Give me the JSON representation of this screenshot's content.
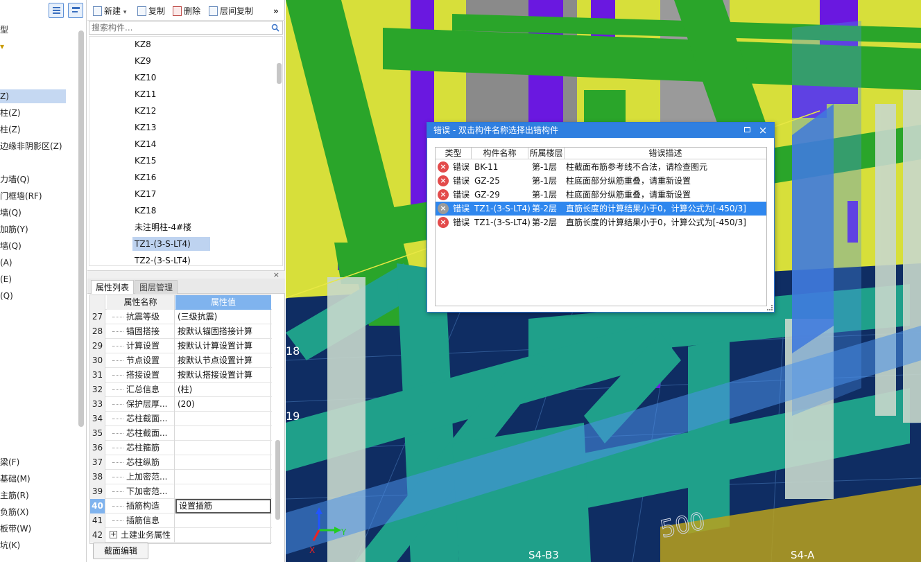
{
  "left_tree": {
    "items": [
      "型",
      "",
      "",
      "",
      "Z)",
      "柱(Z)",
      "柱(Z)",
      "边缘非阴影区(Z)",
      "",
      "力墙(Q)",
      "门框墙(RF)",
      "墙(Q)",
      "加筋(Y)",
      "墙(Q)",
      "(A)",
      "(E)",
      "(Q)",
      "梁(F)",
      "基础(M)",
      "主筋(R)",
      "负筋(X)",
      "板带(W)",
      "坑(K)"
    ]
  },
  "toolbar": {
    "new_label": "新建",
    "copy_label": "复制",
    "delete_label": "删除",
    "floor_copy_label": "层间复制",
    "more_label": "»"
  },
  "search": {
    "placeholder": "搜索构件..."
  },
  "component_list": [
    "KZ8",
    "KZ9",
    "KZ10",
    "KZ11",
    "KZ12",
    "KZ13",
    "KZ14",
    "KZ15",
    "KZ16",
    "KZ17",
    "KZ18",
    "未注明柱-4#楼",
    "TZ1-(3-S-LT4)",
    "TZ2-(3-S-LT4)"
  ],
  "component_selected": "TZ1-(3-S-LT4)",
  "properties": {
    "close_label": "×",
    "tabs": [
      "属性列表",
      "图层管理"
    ],
    "header_name": "属性名称",
    "header_value": "属性值",
    "rows": [
      {
        "num": "27",
        "name": "抗震等级",
        "value": "(三级抗震)"
      },
      {
        "num": "28",
        "name": "锚固搭接",
        "value": "按默认锚固搭接计算"
      },
      {
        "num": "29",
        "name": "计算设置",
        "value": "按默认计算设置计算"
      },
      {
        "num": "30",
        "name": "节点设置",
        "value": "按默认节点设置计算"
      },
      {
        "num": "31",
        "name": "搭接设置",
        "value": "按默认搭接设置计算"
      },
      {
        "num": "32",
        "name": "汇总信息",
        "value": "(柱)"
      },
      {
        "num": "33",
        "name": "保护层厚...",
        "value": "(20)"
      },
      {
        "num": "34",
        "name": "芯柱截面...",
        "value": ""
      },
      {
        "num": "35",
        "name": "芯柱截面...",
        "value": ""
      },
      {
        "num": "36",
        "name": "芯柱箍筋",
        "value": ""
      },
      {
        "num": "37",
        "name": "芯柱纵筋",
        "value": ""
      },
      {
        "num": "38",
        "name": "上加密范...",
        "value": ""
      },
      {
        "num": "39",
        "name": "下加密范...",
        "value": ""
      },
      {
        "num": "40",
        "name": "插筋构造",
        "value": "设置插筋"
      },
      {
        "num": "41",
        "name": "插筋信息",
        "value": ""
      },
      {
        "num": "42",
        "name": "土建业务属性",
        "value": ""
      }
    ],
    "group_expand": "+",
    "section_edit_label": "截面编辑"
  },
  "viewport": {
    "labels": [
      "18",
      "19",
      "S4-B3",
      "S4-A",
      "500"
    ],
    "axis_x": "X",
    "axis_y": "Y",
    "colors": {
      "sky": "#1e3a6e",
      "beam": "#2aa52a",
      "teal": "#1fa08a",
      "purple": "#6a18e0",
      "yellow": "#e8e844",
      "glass": "#4a90e8"
    }
  },
  "error_dialog": {
    "title": "错误 - 双击构件名称选择出错构件",
    "columns": [
      "类型",
      "构件名称",
      "所属楼层",
      "错误描述"
    ],
    "rows": [
      {
        "type": "错误",
        "name": "BK-11",
        "floor": "第-1层",
        "desc": "柱截面布筋参考线不合法，请检查图元"
      },
      {
        "type": "错误",
        "name": "GZ-25",
        "floor": "第-1层",
        "desc": "柱底面部分纵筋重叠，请重新设置"
      },
      {
        "type": "错误",
        "name": "GZ-29",
        "floor": "第-1层",
        "desc": "柱底面部分纵筋重叠，请重新设置"
      },
      {
        "type": "错误",
        "name": "TZ1-(3-S-LT4)",
        "floor": "第-2层",
        "desc": "直筋长度的计算结果小于0，计算公式为[-450/3]"
      },
      {
        "type": "错误",
        "name": "TZ1-(3-S-LT4)",
        "floor": "第-2层",
        "desc": "直筋长度的计算结果小于0，计算公式为[-450/3]"
      }
    ],
    "selected_index": 3
  }
}
